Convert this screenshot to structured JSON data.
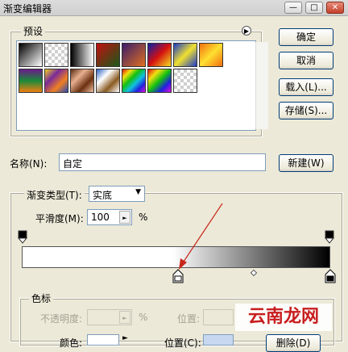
{
  "window": {
    "title": "渐变编辑器"
  },
  "presets": {
    "label": "预设",
    "swatches": [
      {
        "name": "swatch-black-white",
        "bg": "linear-gradient(135deg,#000,#fff)"
      },
      {
        "name": "swatch-black-transparent",
        "bg": "linear-gradient(135deg,rgba(0,0,0,.9),rgba(0,0,0,0))",
        "checker": true
      },
      {
        "name": "swatch-black-white-2",
        "bg": "linear-gradient(90deg,#000,#fff)"
      },
      {
        "name": "swatch-red-green",
        "bg": "linear-gradient(135deg,#c01010,#1a5a1a)"
      },
      {
        "name": "swatch-violet-orange",
        "bg": "linear-gradient(135deg,#3a1c6a,#e07020)"
      },
      {
        "name": "swatch-blue-red-yellow",
        "bg": "linear-gradient(135deg,#0a1fa8,#d41010,#f5e020)"
      },
      {
        "name": "swatch-blue-yellow-blue",
        "bg": "linear-gradient(135deg,#1a3ac8,#f0e030,#1a3ac8)"
      },
      {
        "name": "swatch-orange-yellow-orange",
        "bg": "linear-gradient(135deg,#f07010,#ffe030,#f07010)"
      },
      {
        "name": "swatch-violet-green-orange",
        "bg": "linear-gradient(180deg,#6a1a8a,#1a8a3a,#f08010)"
      },
      {
        "name": "swatch-yellow-violet-orange-blue",
        "bg": "linear-gradient(135deg,#f0d020,#7a2a9a,#f08020,#2a4ab8)"
      },
      {
        "name": "swatch-copper",
        "bg": "linear-gradient(135deg,#5a2a10,#e8b090,#6a3010,#f0c0a0)"
      },
      {
        "name": "swatch-chrome",
        "bg": "linear-gradient(135deg,#2a60c0,#ffffff,#8a5a20,#ffffff)"
      },
      {
        "name": "swatch-spectrum",
        "bg": "linear-gradient(135deg,#e01010,#f0e010,#10c010,#10c0e0,#2020e0,#e010e0)"
      },
      {
        "name": "swatch-transparent-rainbow",
        "bg": "linear-gradient(135deg,#e01010,#f0e010,#10c010,#2020e0,#e010e0)"
      },
      {
        "name": "swatch-transparent-stripes",
        "bg": "repeating-linear-gradient(135deg,rgba(0,0,0,.18) 0 3px,rgba(0,0,0,0) 3px 6px)",
        "checker": true
      }
    ]
  },
  "buttons": {
    "ok": "确定",
    "cancel": "取消",
    "load": "载入(L)...",
    "save": "存储(S)...",
    "new": "新建(W)"
  },
  "name_field": {
    "label": "名称(N):",
    "value": "自定"
  },
  "gradient": {
    "type_label": "渐变类型(T):",
    "type_value": "实底",
    "smoothness_label": "平滑度(M):",
    "smoothness_value": "100",
    "smoothness_unit": "%",
    "start_color": "#ffffff",
    "end_color": "#000000",
    "fade_start_fraction": 0.49
  },
  "color_stops": {
    "label": "色标",
    "opacity_label": "不透明度:",
    "opacity_unit": "%",
    "opacity_location_label": "位置:",
    "color_label": "颜色:",
    "color_location_label": "位置(C):",
    "delete_label": "删除(D)"
  },
  "watermark": "云南龙网"
}
